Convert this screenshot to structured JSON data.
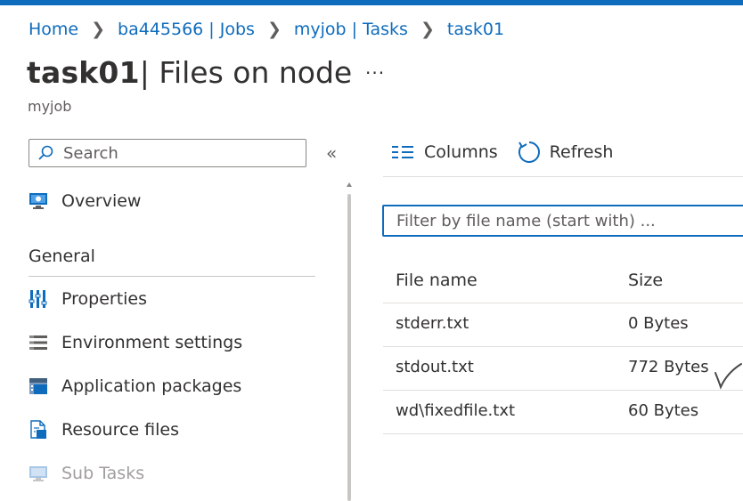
{
  "colors": {
    "accent": "#0f6cbd",
    "text": "#323130",
    "muted": "#605e5c",
    "disabled": "#a19f9d"
  },
  "breadcrumb": [
    {
      "label": "Home"
    },
    {
      "label": "ba445566 | Jobs"
    },
    {
      "label": "myjob | Tasks"
    },
    {
      "label": "task01"
    }
  ],
  "header": {
    "title_strong": "task01",
    "title_rest": " | Files on node",
    "more": "···",
    "subtitle": "myjob"
  },
  "sidebar": {
    "search_placeholder": "Search",
    "collapse": "«",
    "overview": {
      "label": "Overview",
      "icon": "overview-icon"
    },
    "section": "General",
    "items": [
      {
        "label": "Properties",
        "icon": "properties-icon"
      },
      {
        "label": "Environment settings",
        "icon": "environment-settings-icon"
      },
      {
        "label": "Application packages",
        "icon": "application-packages-icon"
      },
      {
        "label": "Resource files",
        "icon": "resource-files-icon"
      },
      {
        "label": "Sub Tasks",
        "icon": "sub-tasks-icon"
      }
    ]
  },
  "toolbar": {
    "columns_label": "Columns",
    "refresh_label": "Refresh"
  },
  "filter": {
    "placeholder": "Filter by file name (start with) ..."
  },
  "table": {
    "headers": {
      "name": "File name",
      "size": "Size"
    },
    "rows": [
      {
        "name": "stderr.txt",
        "size": "0 Bytes"
      },
      {
        "name": "stdout.txt",
        "size": "772 Bytes"
      },
      {
        "name": "wd\\fixedfile.txt",
        "size": "60 Bytes"
      }
    ]
  }
}
